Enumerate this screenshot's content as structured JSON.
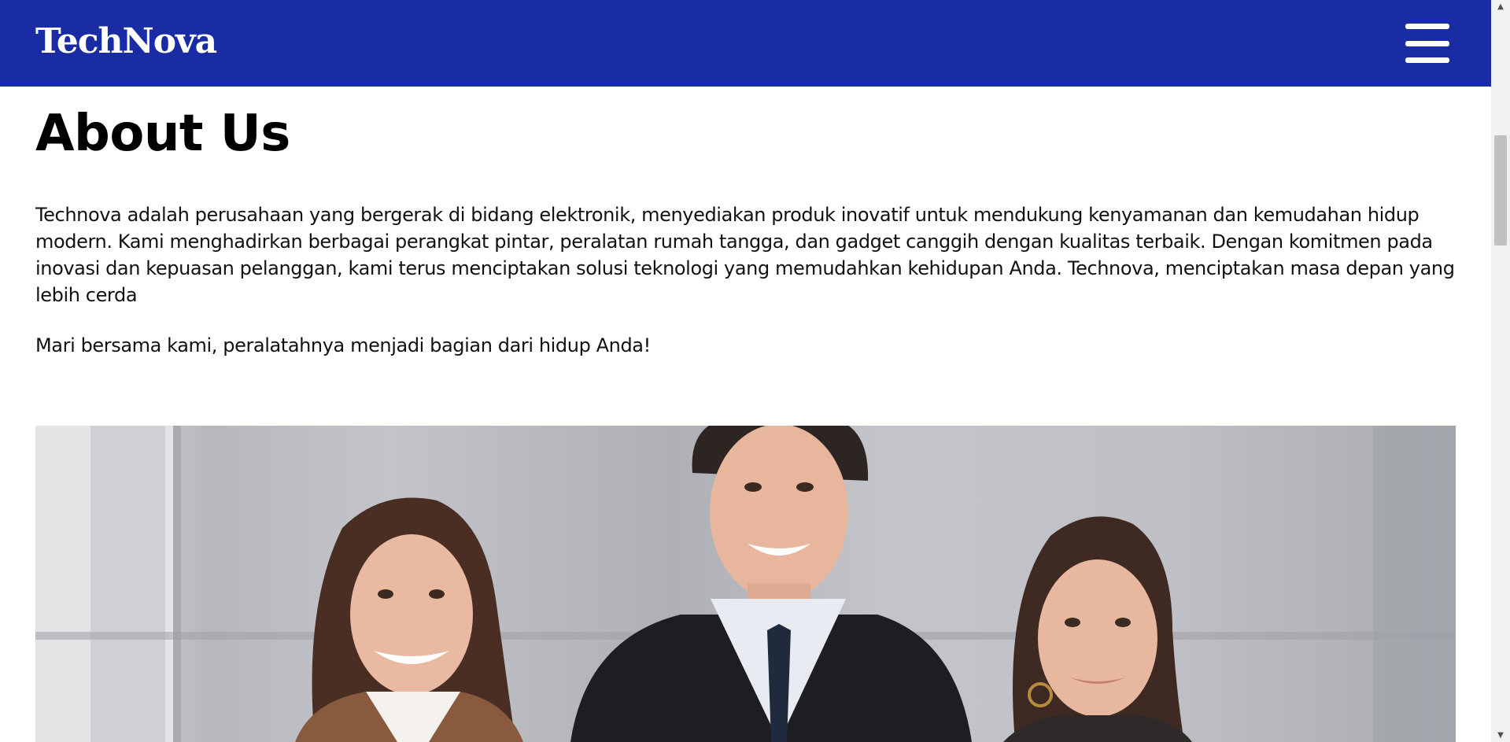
{
  "header": {
    "brand": "TechNova",
    "menu_icon": "hamburger-menu-icon",
    "background_color": "#1a2ca3"
  },
  "about": {
    "heading": "About Us",
    "intro": "Technova adalah perusahaan yang bergerak di bidang elektronik, menyediakan produk inovatif untuk mendukung kenyamanan dan kemudahan hidup modern. Kami menghadirkan berbagai perangkat pintar, peralatan rumah tangga, dan gadget canggih dengan kualitas terbaik. Dengan komitmen pada inovasi dan kepuasan pelanggan, kami terus menciptakan solusi teknologi yang memudahkan kehidupan Anda. Technova, menciptakan masa depan yang lebih cerda",
    "cta": "Mari bersama kami, peralatahnya menjadi bagian dari hidup Anda!"
  },
  "scrollbar": {
    "up_arrow_icon": "scroll-up-arrow-icon",
    "down_arrow_icon": "scroll-down-arrow-icon"
  }
}
